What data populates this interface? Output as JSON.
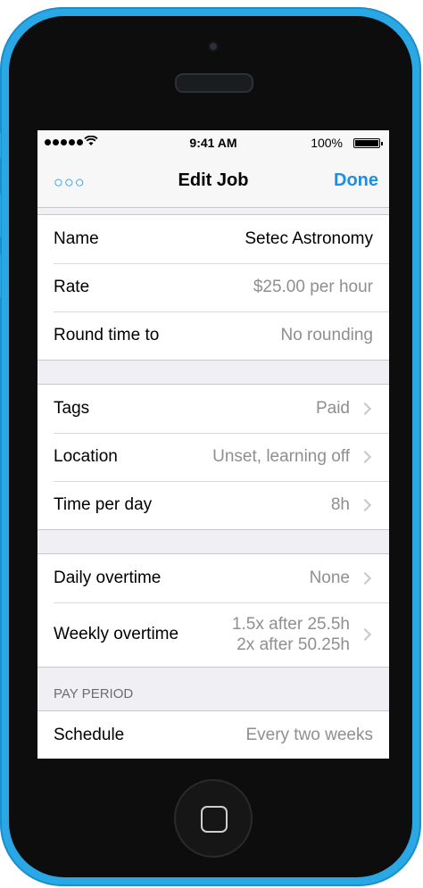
{
  "status_bar": {
    "time": "9:41 AM",
    "battery": "100%"
  },
  "nav": {
    "more": "○○○",
    "title": "Edit Job",
    "done": "Done"
  },
  "group1": [
    {
      "label": "Name",
      "value": "Setec Astronomy"
    },
    {
      "label": "Rate",
      "value": "$25.00 per hour"
    },
    {
      "label": "Round time to",
      "value": "No rounding"
    }
  ],
  "group2": [
    {
      "label": "Tags",
      "value": "Paid"
    },
    {
      "label": "Location",
      "value": "Unset, learning off"
    },
    {
      "label": "Time per day",
      "value": "8h"
    }
  ],
  "group3": [
    {
      "label": "Daily overtime",
      "value": "None"
    },
    {
      "label": "Weekly overtime",
      "value_line1": "1.5x after 25.5h",
      "value_line2": "2x after 50.25h"
    }
  ],
  "pay_period": {
    "header": "PAY PERIOD",
    "rows": [
      {
        "label": "Schedule",
        "value": "Every two weeks"
      }
    ]
  },
  "colors": {
    "accent": "#1a8fe3",
    "device": "#2aa7e5"
  }
}
